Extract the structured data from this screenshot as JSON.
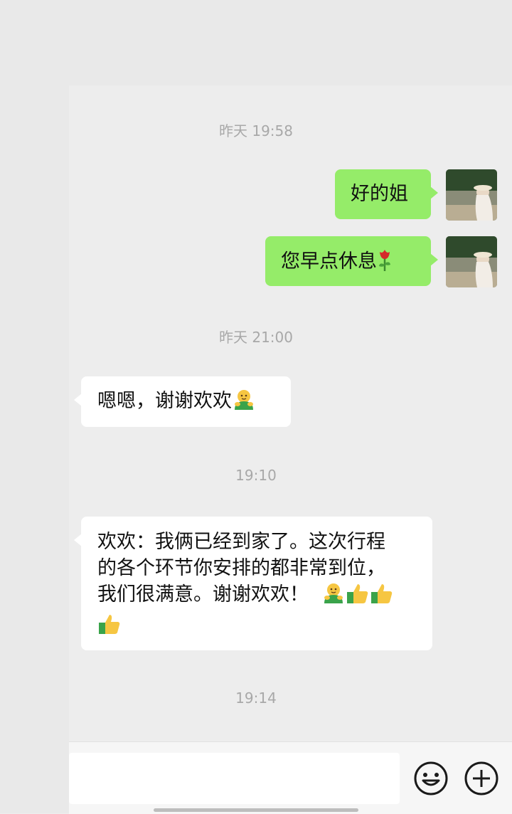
{
  "colors": {
    "self_bubble": "#95ec69",
    "other_bubble": "#ffffff",
    "background": "#ededed",
    "timestamp": "#a8a8a8"
  },
  "timestamps": [
    "昨天 19:58",
    "昨天 21:00",
    "19:10",
    "19:14"
  ],
  "messages": [
    {
      "sender": "self",
      "text": "好的姐",
      "emoji": []
    },
    {
      "sender": "self",
      "text": "您早点休息",
      "emoji": [
        "rose"
      ]
    },
    {
      "sender": "other",
      "text": "嗯嗯，谢谢欢欢",
      "emoji": [
        "hug"
      ]
    },
    {
      "sender": "other",
      "lines": [
        "欢欢：我俩已经到家了。这次行程",
        "的各个环节你安排的都非常到位，",
        "我们很满意。谢谢欢欢！"
      ],
      "emoji": [
        "hug",
        "thumbs-up",
        "thumbs-up",
        "thumbs-up"
      ]
    }
  ],
  "input_bar": {
    "text": "",
    "buttons": [
      "emoji-icon",
      "plus-icon"
    ]
  }
}
